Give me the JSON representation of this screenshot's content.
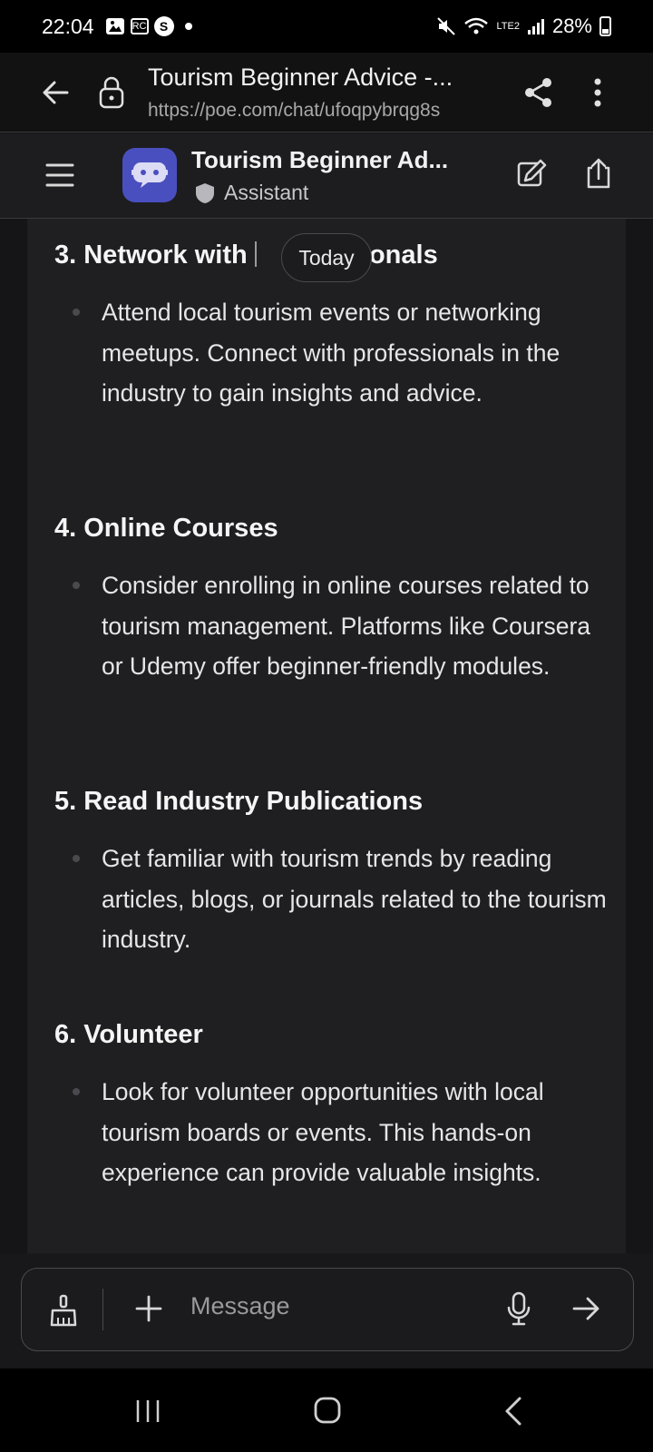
{
  "status_bar": {
    "time": "22:04",
    "battery": "28%",
    "network": "LTE2"
  },
  "browser": {
    "title": "Tourism Beginner Advice -...",
    "url": "https://poe.com/chat/ufoqpybrqg8s"
  },
  "chat_header": {
    "bot_name": "Tourism Beginner Ad...",
    "badge": "Assistant"
  },
  "date_pill": "Today",
  "sections": [
    {
      "heading": "3. Network with Professionals",
      "heading_start": "3. Network with ",
      "heading_end": "sionals",
      "bullet": "Attend local tourism events or networking meetups. Connect with professionals in the industry to gain insights and advice."
    },
    {
      "heading": "4. Online Courses",
      "bullet": "Consider enrolling in online courses related to tourism management. Platforms like Coursera or Udemy offer beginner-friendly modules."
    },
    {
      "heading": "5. Read Industry Publications",
      "bullet": "Get familiar with tourism trends by reading articles, blogs, or journals related to the tourism industry."
    },
    {
      "heading": "6. Volunteer",
      "bullet": "Look for volunteer opportunities with local tourism boards or events. This hands-on experience can provide valuable insights."
    }
  ],
  "composer": {
    "placeholder": "Message"
  },
  "colors": {
    "background": "#141416",
    "card": "#1f1f22",
    "avatar": "#4a4fbf",
    "text": "#e6e6e6"
  }
}
